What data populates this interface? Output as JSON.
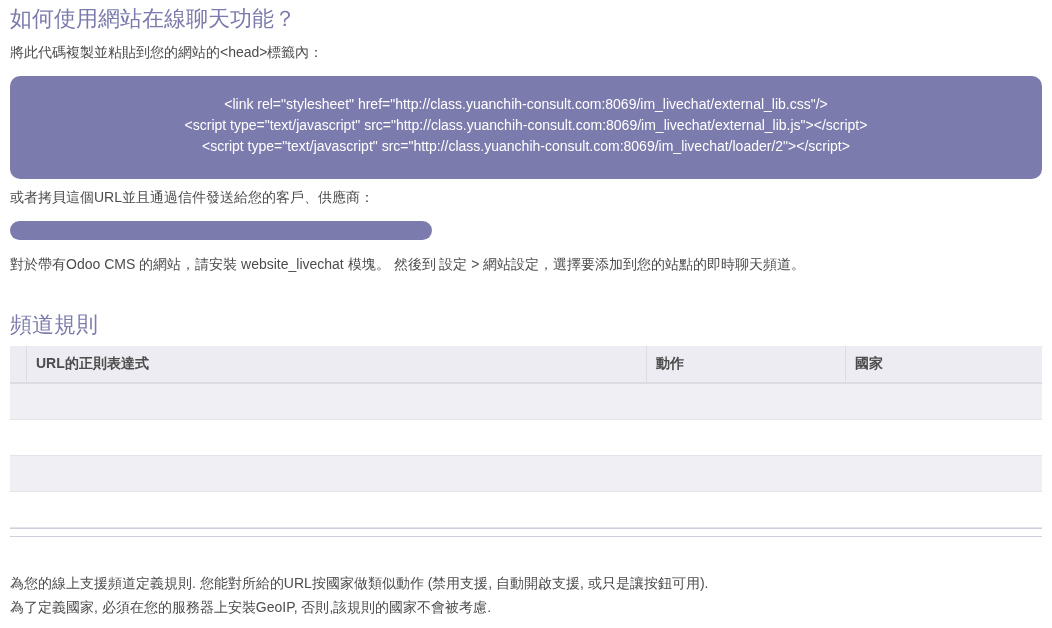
{
  "intro": {
    "title": "如何使用網站在線聊天功能？",
    "instruction": "將此代碼複製並粘貼到您的網站的<head>標籤內：",
    "code_lines": [
      "<link rel=\"stylesheet\" href=\"http://class.yuanchih-consult.com:8069/im_livechat/external_lib.css\"/>",
      "<script type=\"text/javascript\" src=\"http://class.yuanchih-consult.com:8069/im_livechat/external_lib.js\"></script>",
      "<script type=\"text/javascript\" src=\"http://class.yuanchih-consult.com:8069/im_livechat/loader/2\"></script>"
    ],
    "url_instruction": "或者拷貝這個URL並且通過信件發送給您的客戶、供應商：",
    "cms_note": "對於帶有Odoo CMS 的網站，請安裝 website_livechat 模塊。 然後到 設定 > 網站設定，選擇要添加到您的站點的即時聊天頻道。"
  },
  "rules": {
    "title": "頻道規則",
    "table": {
      "columns": [
        "URL的正則表達式",
        "動作",
        "國家"
      ]
    },
    "notes": [
      "為您的線上支援頻道定義規則. 您能對所給的URL按國家做類似動作 (禁用支援, 自動開啟支援, 或只是讓按鈕可用).",
      "為了定義國家, 必須在您的服務器上安裝GeoIP, 否則,該規則的國家不會被考慮."
    ]
  }
}
